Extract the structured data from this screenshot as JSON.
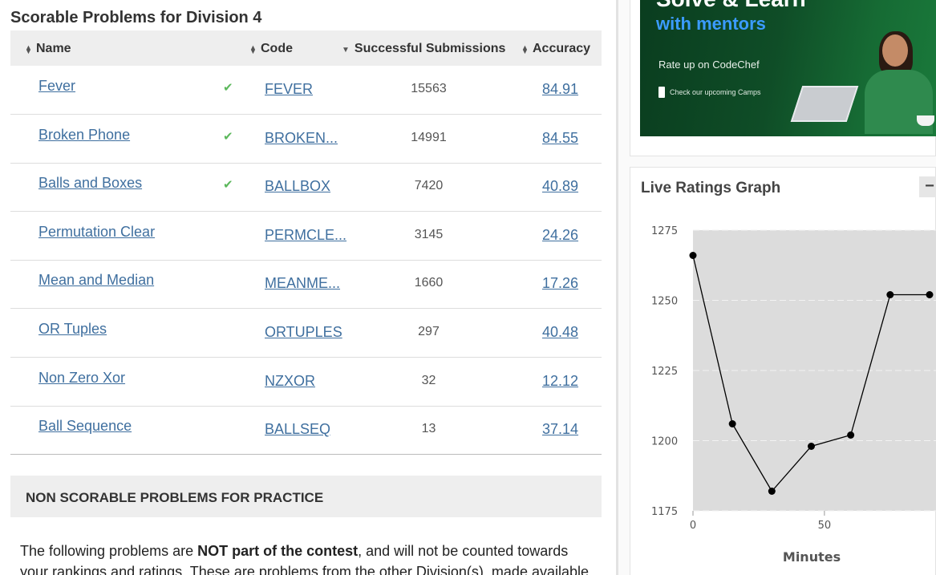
{
  "section_title": "Scorable Problems for Division 4",
  "table": {
    "headers": {
      "name": "Name",
      "code": "Code",
      "submissions": "Successful Submissions",
      "accuracy": "Accuracy"
    },
    "rows": [
      {
        "name": "Fever",
        "solved": true,
        "code": "FEVER",
        "submissions": "15563",
        "accuracy": "84.91"
      },
      {
        "name": "Broken Phone",
        "solved": true,
        "code": "BROKEN...",
        "submissions": "14991",
        "accuracy": "84.55"
      },
      {
        "name": "Balls and Boxes",
        "solved": true,
        "code": "BALLBOX",
        "submissions": "7420",
        "accuracy": "40.89"
      },
      {
        "name": "Permutation Clear",
        "solved": false,
        "code": "PERMCLE...",
        "submissions": "3145",
        "accuracy": "24.26"
      },
      {
        "name": "Mean and Median",
        "solved": false,
        "code": "MEANME...",
        "submissions": "1660",
        "accuracy": "17.26"
      },
      {
        "name": "OR Tuples",
        "solved": false,
        "code": "ORTUPLES",
        "submissions": "297",
        "accuracy": "40.48"
      },
      {
        "name": "Non Zero Xor",
        "solved": false,
        "code": "NZXOR",
        "submissions": "32",
        "accuracy": "12.12"
      },
      {
        "name": "Ball Sequence",
        "solved": false,
        "code": "BALLSEQ",
        "submissions": "13",
        "accuracy": "37.14"
      }
    ]
  },
  "non_scorable": {
    "title": "NON SCORABLE PROBLEMS FOR PRACTICE",
    "para_pre": "The following problems are ",
    "para_bold": "NOT part of the contest",
    "para_post": ", and will not be counted towards your rankings and ratings. These are problems from the other Division(s), made available for you"
  },
  "ad": {
    "top_text": "Solve & Learn",
    "mentors_text": "with mentors",
    "rate_text": "Rate up on CodeChef",
    "camps_text": "Check our upcoming Camps"
  },
  "graph": {
    "title": "Live Ratings Graph",
    "collapse_label": "−"
  },
  "chart_data": {
    "type": "line",
    "x": [
      0,
      15,
      30,
      45,
      60,
      75,
      90
    ],
    "y": [
      1266,
      1206,
      1182,
      1198,
      1202,
      1252,
      1252
    ],
    "xlabel": "Minutes",
    "ylabel": "",
    "xlim": [
      0,
      90
    ],
    "ylim": [
      1175,
      1275
    ],
    "yticks": [
      "1275",
      "1250",
      "1225",
      "1200",
      "1175"
    ],
    "xticks": [
      "0",
      "50"
    ],
    "grid": true
  },
  "colors": {
    "link": "#3f6f9f",
    "check": "#5cb85c",
    "plot_bg": "#dcdcdc"
  }
}
